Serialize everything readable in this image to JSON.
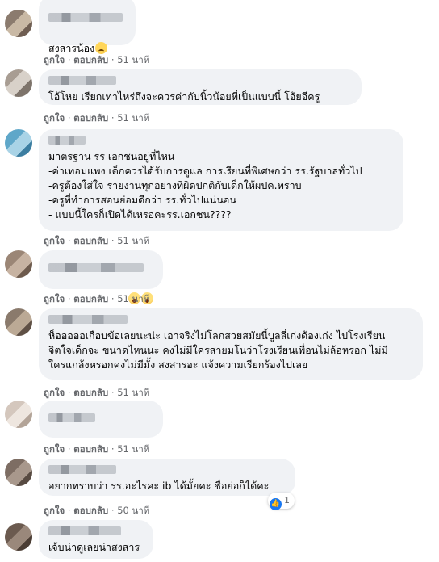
{
  "colors": {
    "bubble": "#f0f2f5",
    "action_text": "#65676b",
    "like_blue": "#1877f2"
  },
  "actions": {
    "like": "ถูกใจ",
    "reply": "ตอบกลับ",
    "separator": " · "
  },
  "comments": [
    {
      "text": "สงสารน้อง",
      "emoji": "sad-face-icon",
      "time": "51 นาที"
    },
    {
      "text": "โอ้โหย เรียกเท่าไหร่ถึงจะควรค่ากับนิ้วน้อยที่เป็นแบบนี้ โอ้ยอีครู",
      "time": "51 นาที"
    },
    {
      "text": "มาตรฐาน รร เอกชนอยู่ที่ไหน\n-ค่าเทอมแพง เด็กควรได้รับการดูแล การเรียนที่พิเศษกว่า รร.รัฐบาลทั่วไป\n-ครูต้องใส่ใจ รายงานทุกอย่างที่ผิดปกติกับเด็กให้ผปค.ทราบ\n-ครูที่ทำการสอนย่อมดีกว่า รร.ทั่วไปแน่นอน\n- แบบนี้ใครก็เปิดได้เหรอคะรร.เอกชน????",
      "time": "51 นาที"
    },
    {
      "text": "",
      "emoji": "shocked-face-icon",
      "time": "51 นาที"
    },
    {
      "text": "ห็อออออเกือบข้อเลยนะน่ะ เอาจริงไม่โลกสวยสมัยนี้บูลลี่เก่งด้องเก่ง ไปโรงเรียน\nจิตใจเด็กจะ ขนาดไหนนะ คงไม่มีใครสายมโนว่าโรงเรียนเพื่อนไม่ล้อหรอก ไม่มี\nใครแกล้งหรอกคงไม่มีมั้ง สงสารอะ แจ้งความเรียกร้องไปเลย",
      "time": "51 นาที"
    },
    {
      "text": "",
      "time": "51 นาที"
    },
    {
      "text": "อยากทราบว่า รร.อะไรคะ ib ได้มั้ยคะ ชื่อย่อก็ได้คะ",
      "time": "50 นาที",
      "reactions": "1"
    },
    {
      "text": "เจ้บน่าดูเลยน่าสงสาร"
    }
  ]
}
